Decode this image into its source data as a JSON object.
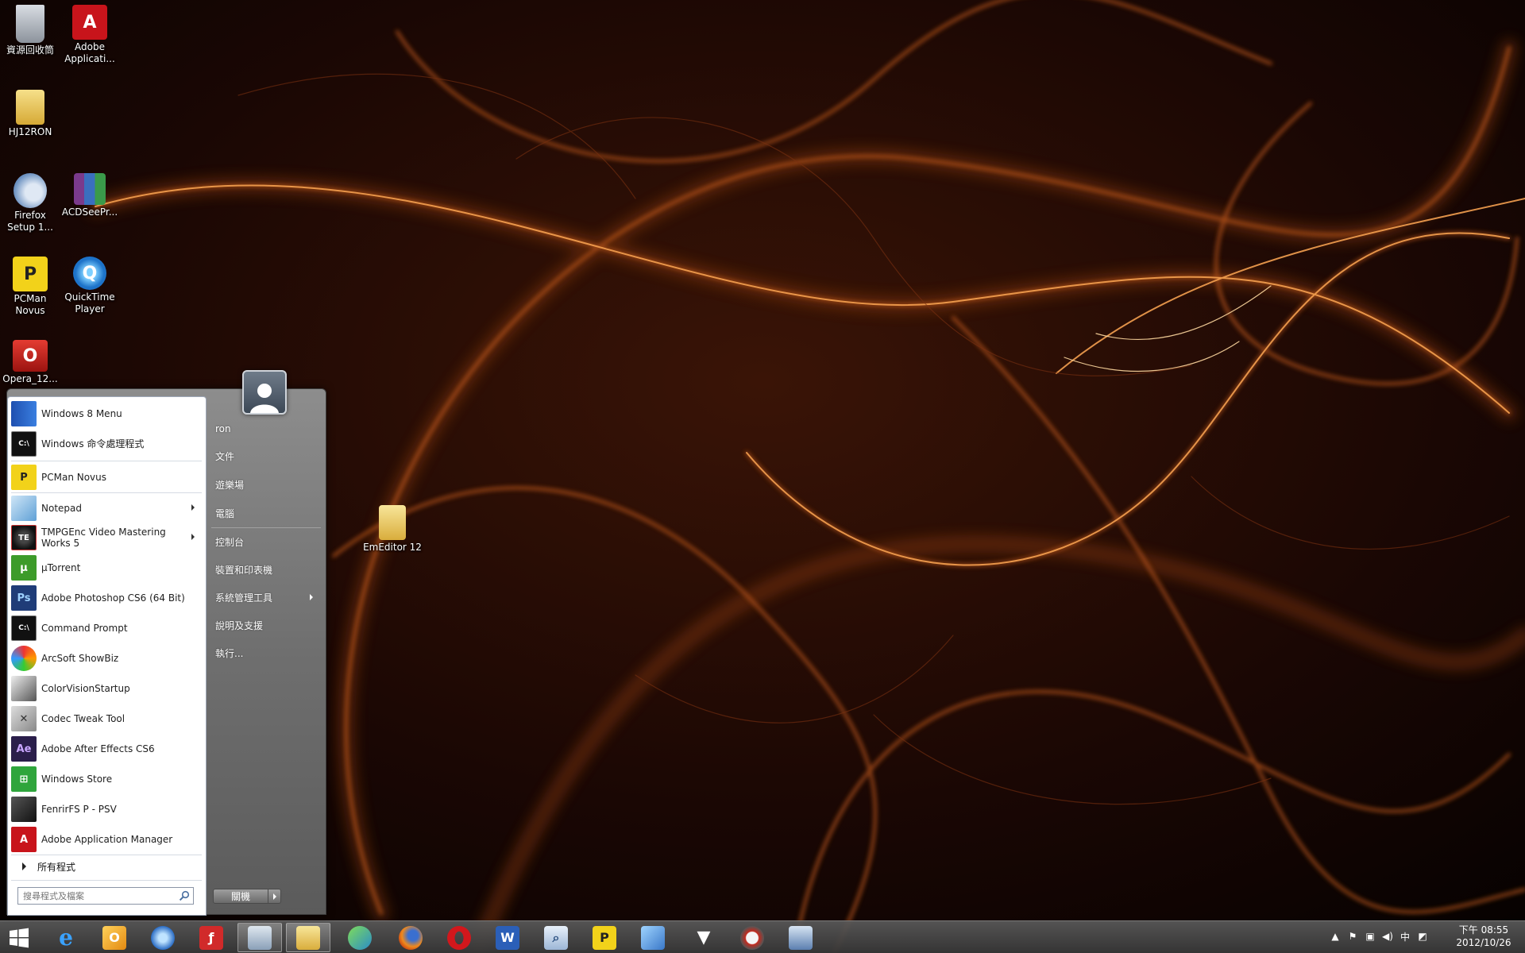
{
  "desktop": {
    "icons": [
      {
        "label": "資源回收筒",
        "icon": "recycle-bin-icon"
      },
      {
        "label": "Adobe Applicati...",
        "icon": "adobe-icon"
      },
      {
        "label": "HJ12RON",
        "icon": "folder-icon"
      },
      {
        "label": "Firefox Setup 1...",
        "icon": "installer-icon"
      },
      {
        "label": "ACDSeePr...",
        "icon": "winrar-icon"
      },
      {
        "label": "PCMan Novus",
        "icon": "pcman-icon"
      },
      {
        "label": "QuickTime Player",
        "icon": "quicktime-icon"
      },
      {
        "label": "Opera_12...",
        "icon": "opera-installer-icon"
      },
      {
        "label": "EmEditor 12",
        "icon": "folder-icon"
      }
    ]
  },
  "start_menu": {
    "programs": [
      {
        "label": "Windows 8 Menu",
        "icon": "windows8-menu-icon",
        "submenu": false
      },
      {
        "label": "Windows 命令處理程式",
        "icon": "cmd-icon",
        "submenu": false
      },
      {
        "label": "PCMan Novus",
        "icon": "pcman-icon",
        "submenu": false
      },
      {
        "label": "Notepad",
        "icon": "notepad-icon",
        "submenu": true
      },
      {
        "label": "TMPGEnc Video Mastering Works 5",
        "icon": "tmpgenc-icon",
        "submenu": true
      },
      {
        "label": "µTorrent",
        "icon": "utorrent-icon",
        "submenu": false
      },
      {
        "label": "Adobe Photoshop CS6 (64 Bit)",
        "icon": "photoshop-icon",
        "submenu": false
      },
      {
        "label": "Command Prompt",
        "icon": "cmd-icon",
        "submenu": false
      },
      {
        "label": "ArcSoft ShowBiz",
        "icon": "arcsoft-icon",
        "submenu": false
      },
      {
        "label": "ColorVisionStartup",
        "icon": "colorvision-icon",
        "submenu": false
      },
      {
        "label": "Codec Tweak Tool",
        "icon": "tools-icon",
        "submenu": false
      },
      {
        "label": "Adobe After Effects CS6",
        "icon": "after-effects-icon",
        "submenu": false
      },
      {
        "label": "Windows Store",
        "icon": "windows-store-icon",
        "submenu": false
      },
      {
        "label": "FenrirFS P - PSV",
        "icon": "fenrirfs-icon",
        "submenu": false
      },
      {
        "label": "Adobe Application Manager",
        "icon": "adobe-icon",
        "submenu": false
      }
    ],
    "all_programs": "所有程式",
    "search_placeholder": "搜尋程式及檔案",
    "right_links": [
      {
        "label": "ron",
        "submenu": false
      },
      {
        "label": "文件",
        "submenu": false
      },
      {
        "label": "遊樂場",
        "submenu": false
      },
      {
        "label": "電腦",
        "submenu": false
      },
      {
        "label": "控制台",
        "submenu": false
      },
      {
        "label": "裝置和印表機",
        "submenu": false
      },
      {
        "label": "系統管理工具",
        "submenu": true
      },
      {
        "label": "說明及支援",
        "submenu": false
      },
      {
        "label": "執行...",
        "submenu": false
      }
    ],
    "shutdown_label": "關機"
  },
  "taskbar": {
    "buttons": [
      {
        "icon": "windows-start-icon",
        "active": false
      },
      {
        "icon": "internet-explorer-icon",
        "active": false
      },
      {
        "icon": "outlook-icon",
        "active": false
      },
      {
        "icon": "network-globe-icon",
        "active": false
      },
      {
        "icon": "flash-icon",
        "active": false
      },
      {
        "icon": "system-monitor-icon",
        "active": true
      },
      {
        "icon": "file-explorer-icon",
        "active": true
      },
      {
        "icon": "messenger-icon",
        "active": false
      },
      {
        "icon": "firefox-icon",
        "active": false
      },
      {
        "icon": "opera-icon",
        "active": false
      },
      {
        "icon": "word-icon",
        "active": false
      },
      {
        "icon": "search-tool-icon",
        "active": false
      },
      {
        "icon": "pcman-icon",
        "active": false
      },
      {
        "icon": "control-panel-icon",
        "active": false
      },
      {
        "icon": "fox-app-icon",
        "active": false
      },
      {
        "icon": "compass-icon",
        "active": false
      },
      {
        "icon": "remote-desktop-icon",
        "active": false
      }
    ],
    "tray": {
      "icons": [
        "chevron-up-icon",
        "flag-icon",
        "network-icon",
        "volume-icon",
        "ime-icon",
        "ime-mode-icon"
      ],
      "ime_label": "中",
      "time": "下午 08:55",
      "date": "2012/10/26"
    }
  },
  "colors": {
    "wallpaper_base": "#0a0302",
    "wallpaper_glow": "#e07a2a",
    "start_menu_frame": "#6f6f6f",
    "taskbar": "#4a4a4a"
  }
}
